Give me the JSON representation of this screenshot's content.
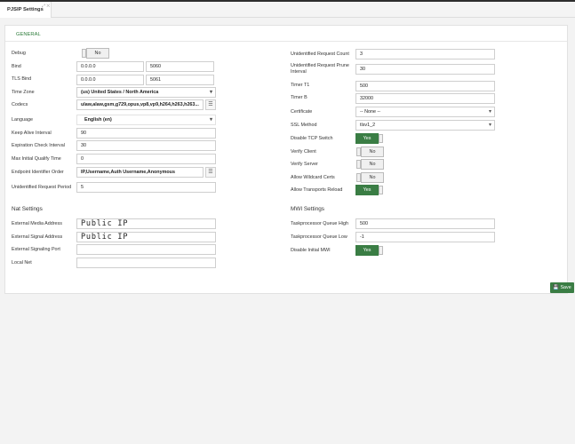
{
  "tab": {
    "label": "PJSIP Settings",
    "icons": "⤢ ✕"
  },
  "panel_title": "GENERAL",
  "general_left": {
    "debug": {
      "label": "Debug",
      "value": "No"
    },
    "bind": {
      "label": "Bind",
      "ip": "0.0.0.0",
      "port": "5060"
    },
    "tls_bind": {
      "label": "TLS Bind",
      "ip": "0.0.0.0",
      "port": "5061"
    },
    "time_zone": {
      "label": "Time Zone",
      "value": "(us) United States / North America"
    },
    "codecs": {
      "label": "Codecs",
      "value": "ulaw,alaw,gsm,g729,opus,vp8,vp9,h264,h263,h263..."
    },
    "language": {
      "label": "Language",
      "value": "English (en)"
    },
    "keep_alive": {
      "label": "Keep Alive Interval",
      "value": "90"
    },
    "expiration_check": {
      "label": "Expiration Check Interval",
      "value": "30"
    },
    "max_qualify": {
      "label": "Max Initial Qualify Time",
      "value": "0"
    },
    "endpoint_identifier": {
      "label": "Endpoint Identifier Order",
      "value": "IP,Username,Auth Username,Anonymous"
    },
    "unidentified_period": {
      "label": "Unidentified Request Period",
      "value": "5"
    }
  },
  "general_right": {
    "unidentified_count": {
      "label": "Unidentified Request Count",
      "value": "3"
    },
    "unidentified_prune": {
      "label1": "Unidentified Request Prune",
      "label2": "Interval",
      "value": "30"
    },
    "timer_t1": {
      "label": "Timer T1",
      "value": "500"
    },
    "timer_b": {
      "label": "Timer B",
      "value": "32000"
    },
    "certificate": {
      "label": "Certificate",
      "value": "-- None --"
    },
    "ssl_method": {
      "label": "SSL Method",
      "value": "tlsv1_2"
    },
    "disable_tcp": {
      "label": "Disable TCP Switch",
      "value": "Yes"
    },
    "verify_client": {
      "label": "Verify Client",
      "value": "No"
    },
    "verify_server": {
      "label": "Verify Server",
      "value": "No"
    },
    "allow_wildcard": {
      "label": "Allow Wildcard Certs",
      "value": "No"
    },
    "allow_transports": {
      "label": "Allow Transports Reload",
      "value": "Yes"
    }
  },
  "nat": {
    "title": "Nat Settings",
    "media_address": {
      "label": "External Media Address",
      "value": "Public IP"
    },
    "signal_address": {
      "label": "External Signal Address",
      "value": "Public IP"
    },
    "signaling_port": {
      "label": "External Signaling Port",
      "value": ""
    },
    "local_net": {
      "label": "Local Net",
      "value": ""
    }
  },
  "mwi": {
    "title": "MWI Settings",
    "queue_high": {
      "label": "Taskprocessor Queue High",
      "value": "500"
    },
    "queue_low": {
      "label": "Taskprocessor Queue Low",
      "value": "-1"
    },
    "disable_initial": {
      "label": "Disable Initial MWI",
      "value": "Yes"
    }
  },
  "save_label": "Save"
}
